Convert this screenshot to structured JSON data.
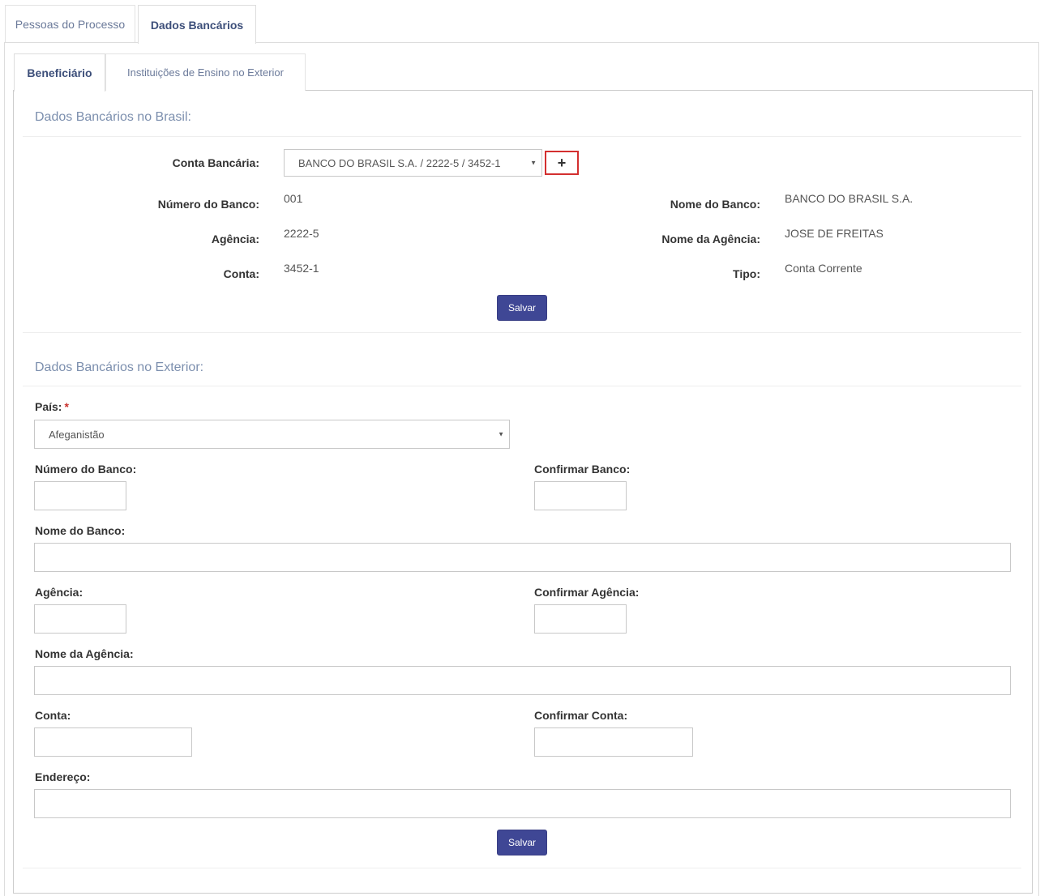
{
  "tabs_top": {
    "pessoas": "Pessoas do Processo",
    "dados": "Dados Bancários"
  },
  "tabs_inner": {
    "beneficiario": "Beneficiário",
    "instituicoes": "Instituições de Ensino no Exterior"
  },
  "brasil": {
    "title": "Dados Bancários no Brasil:",
    "conta_label": "Conta Bancária:",
    "conta_selected": "BANCO DO BRASIL S.A. / 2222-5 / 3452-1",
    "add_icon": "plus-icon",
    "numero_banco_label": "Número do Banco:",
    "numero_banco": "001",
    "nome_banco_label": "Nome do Banco:",
    "nome_banco": "BANCO DO BRASIL S.A.",
    "agencia_label": "Agência:",
    "agencia": "2222-5",
    "nome_agencia_label": "Nome da Agência:",
    "nome_agencia": "JOSE DE FREITAS",
    "conta_num_label": "Conta:",
    "conta_num": "3452-1",
    "tipo_label": "Tipo:",
    "tipo": "Conta Corrente",
    "save_label": "Salvar"
  },
  "exterior": {
    "title": "Dados Bancários no Exterior:",
    "pais_label": "País:",
    "pais_required": "*",
    "pais_selected": "Afeganistão",
    "numero_banco_label": "Número do Banco:",
    "confirmar_banco_label": "Confirmar Banco:",
    "nome_banco_label": "Nome do Banco:",
    "agencia_label": "Agência:",
    "confirmar_agencia_label": "Confirmar Agência:",
    "nome_agencia_label": "Nome da Agência:",
    "conta_label": "Conta:",
    "confirmar_conta_label": "Confirmar Conta:",
    "endereco_label": "Endereço:",
    "save_label": "Salvar"
  },
  "colors": {
    "accent": "#3f4795",
    "highlight_border": "#d32f2f",
    "section_title": "#7c8fae"
  }
}
